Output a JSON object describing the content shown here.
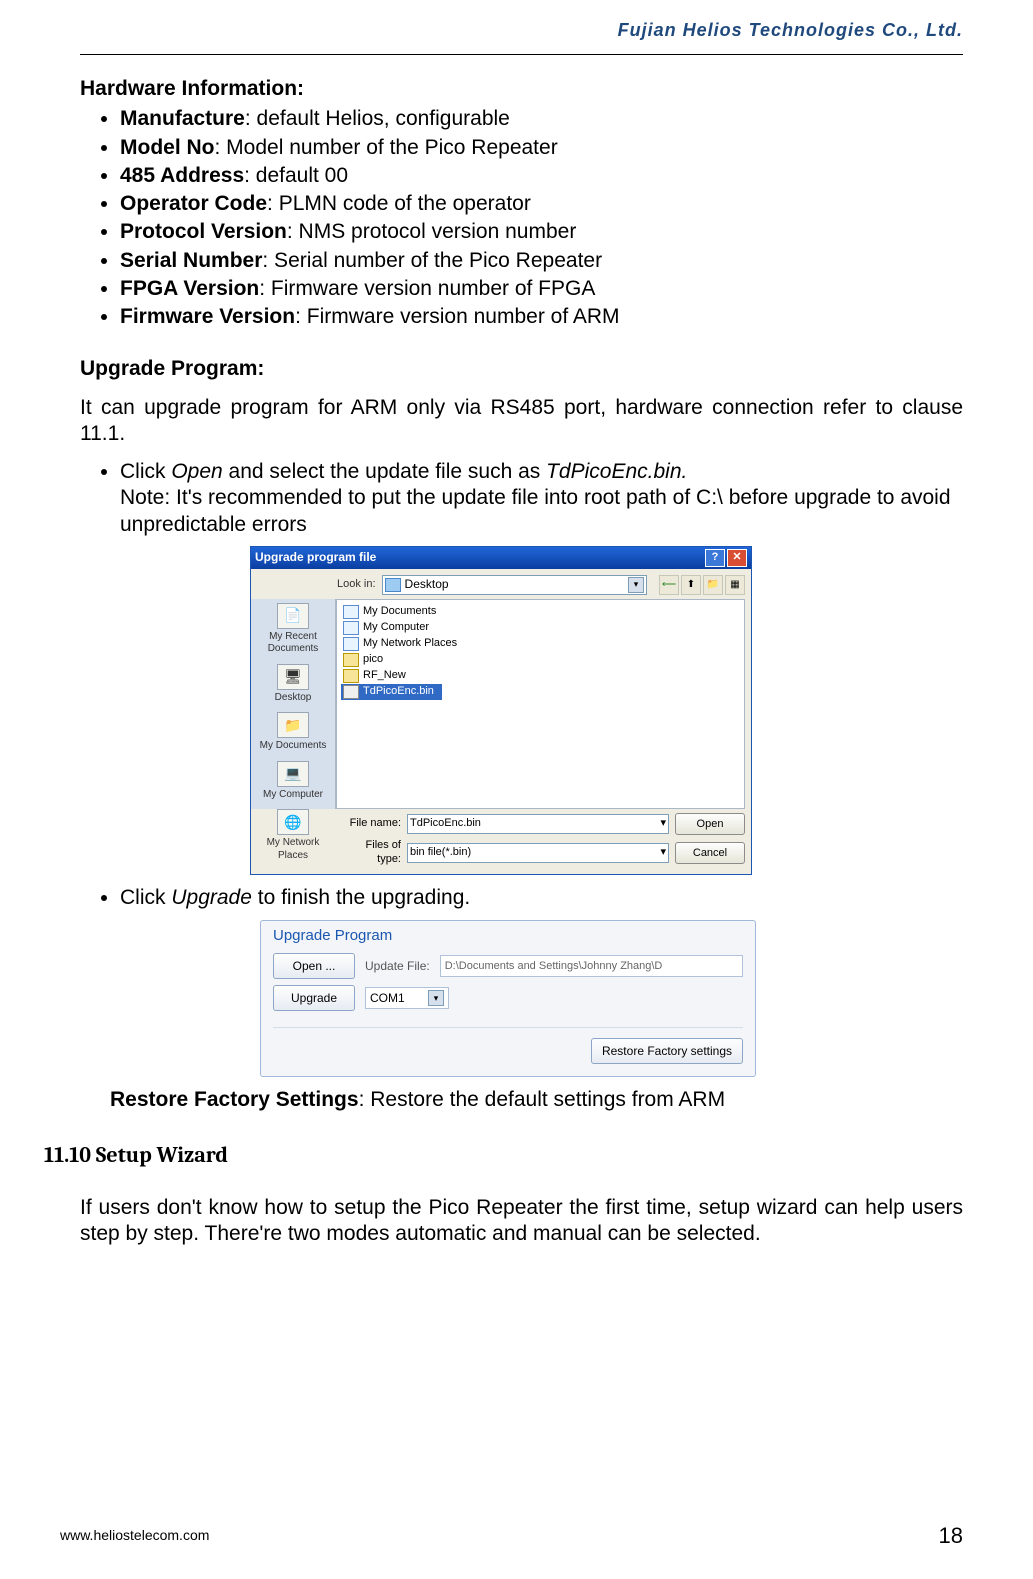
{
  "header": {
    "company": "Fujian  Helios  Technologies  Co.,  Ltd."
  },
  "footer": {
    "url": "www.heliostelecom.com",
    "page": "18"
  },
  "hw": {
    "title": "Hardware Information:",
    "items": [
      {
        "label": "Manufacture",
        "desc": ": default Helios, configurable"
      },
      {
        "label": "Model No",
        "desc": ": Model number of the Pico Repeater"
      },
      {
        "label": "485 Address",
        "desc": ": default 00"
      },
      {
        "label": "Operator Code",
        "desc": ": PLMN code of the operator"
      },
      {
        "label": "Protocol Version",
        "desc": ": NMS protocol version number"
      },
      {
        "label": "Serial Number",
        "desc": ": Serial number of the Pico Repeater"
      },
      {
        "label": "FPGA Version",
        "desc": ": Firmware version number of FPGA"
      },
      {
        "label": "Firmware Version",
        "desc": ": Firmware version number of ARM"
      }
    ]
  },
  "upgrade": {
    "title": "Upgrade Program:",
    "intro": "It can upgrade program for ARM only via RS485 port, hardware connection refer to clause 11.1.",
    "bullet1_pre": "Click ",
    "bullet1_open": "Open",
    "bullet1_mid": " and select the update file such as ",
    "bullet1_file": "TdPicoEnc.bin.",
    "bullet1_note": "Note: It's recommended to put the update file into root path of C:\\ before upgrade to avoid unpredictable errors",
    "bullet2_pre": "Click ",
    "bullet2_cmd": "Upgrade",
    "bullet2_post": " to finish the upgrading.",
    "restore_label": "Restore Factory Settings",
    "restore_desc": ": Restore the default settings from ARM"
  },
  "dlg1": {
    "title": "Upgrade program file",
    "lookin_label": "Look in:",
    "lookin_value": "Desktop",
    "places": [
      {
        "name": "My Recent Documents",
        "icon": "📄"
      },
      {
        "name": "Desktop",
        "icon": "🖥"
      },
      {
        "name": "My Documents",
        "icon": "📁"
      },
      {
        "name": "My Computer",
        "icon": "💻"
      },
      {
        "name": "My Network Places",
        "icon": "🌐"
      }
    ],
    "files": [
      {
        "name": "My Documents",
        "type": "doc"
      },
      {
        "name": "My Computer",
        "type": "doc"
      },
      {
        "name": "My Network Places",
        "type": "doc"
      },
      {
        "name": "pico",
        "type": "folder"
      },
      {
        "name": "RF_New",
        "type": "folder"
      },
      {
        "name": "TdPicoEnc.bin",
        "type": "bin",
        "selected": true
      }
    ],
    "filename_label": "File name:",
    "filename_value": "TdPicoEnc.bin",
    "filetype_label": "Files of type:",
    "filetype_value": "bin file(*.bin)",
    "open_btn": "Open",
    "cancel_btn": "Cancel"
  },
  "dlg2": {
    "title": "Upgrade Program",
    "open_btn": "Open ...",
    "update_label": "Update File:",
    "path_value": "D:\\Documents and Settings\\Johnny Zhang\\D",
    "upgrade_btn": "Upgrade",
    "com_value": "COM1",
    "restore_btn": "Restore Factory settings"
  },
  "wizard": {
    "heading": "11.10 Setup Wizard",
    "para": "If users don't know how to setup the Pico Repeater the first time, setup wizard can help users step by step. There're two modes automatic and manual can be selected."
  }
}
